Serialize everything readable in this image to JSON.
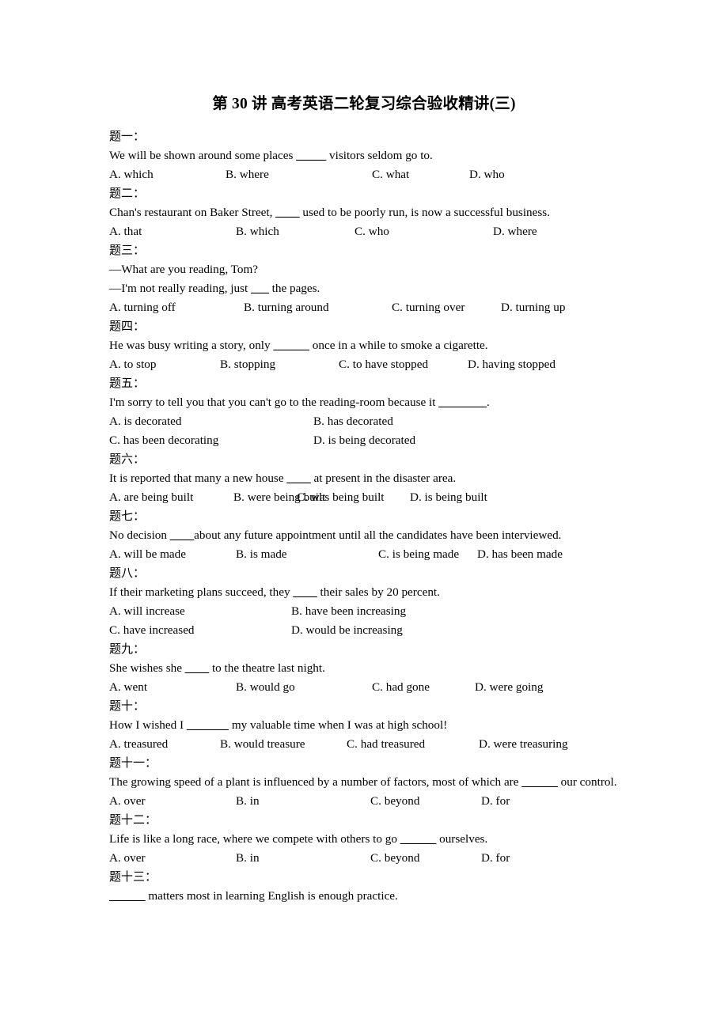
{
  "document": {
    "title": "第 30 讲 高考英语二轮复习综合验收精讲(三)"
  },
  "questions": [
    {
      "label": "题一：",
      "stem_before": "We will be shown around some places ",
      "blank": "_____",
      "stem_after": " visitors seldom go to.",
      "layout": "four-column",
      "options": [
        "A. which",
        "B. where",
        "C. what",
        "D. who"
      ],
      "columns": [
        0,
        147,
        332,
        455
      ]
    },
    {
      "label": "题二：",
      "stem_before": "Chan's restaurant on Baker Street, ",
      "blank": "____",
      "stem_after": " used to be poorly run, is now a successful business.",
      "layout": "four-column",
      "options": [
        "A. that",
        "B. which",
        "C. who",
        "D. where"
      ],
      "columns": [
        0,
        160,
        310,
        485
      ]
    },
    {
      "label": "题三：",
      "dialog": [
        "—What are you reading, Tom?"
      ],
      "stem_before": "—I'm not really reading, just ",
      "blank": "___",
      "stem_after": " the pages.",
      "layout": "four-column",
      "options": [
        "A. turning off",
        "B. turning around",
        "C. turning over",
        "D. turning up"
      ],
      "columns": [
        0,
        170,
        357,
        495
      ]
    },
    {
      "label": "题四：",
      "stem_before": "He was busy writing a story, only ",
      "blank": "______",
      "stem_after": " once in a while to smoke a cigarette.",
      "layout": "four-column",
      "options": [
        "A. to stop",
        "B. stopping",
        "C. to have stopped",
        "D. having stopped"
      ],
      "columns": [
        0,
        140,
        290,
        453
      ]
    },
    {
      "label": "题五：",
      "stem_before": "I'm sorry to tell you that you can't go to the reading-room because it ",
      "blank": "________",
      "stem_after": ".",
      "layout": "two-column",
      "options": [
        "A. is decorated",
        "B. has decorated",
        "C. has been decorating",
        "D. is being decorated"
      ],
      "columns": [
        0,
        258
      ]
    },
    {
      "label": "题六：",
      "stem_before": "It is reported that many a new house  ",
      "blank": "____",
      "stem_after": "  at present in the disaster area.",
      "layout": "four-column",
      "options": [
        "A. are being built",
        "B. were being built",
        "C. was being built",
        "D. is being built"
      ],
      "columns": [
        0,
        157,
        237,
        380
      ]
    },
    {
      "label": "题七：",
      "stem_before": "No decision ",
      "blank": "____",
      "stem_after": "about any future appointment until all the candidates have been interviewed.",
      "layout": "four-column",
      "options": [
        "A. will be made",
        "B. is made",
        "C. is being made",
        "D. has been made"
      ],
      "columns": [
        0,
        160,
        340,
        465
      ]
    },
    {
      "label": "题八：",
      "stem_before": "If their marketing plans succeed, they ",
      "blank": "____",
      "stem_after": " their sales by 20 percent.",
      "layout": "two-column",
      "options": [
        "A. will increase",
        "B. have been increasing",
        "C. have increased",
        "D. would be increasing"
      ],
      "columns": [
        0,
        230
      ]
    },
    {
      "label": "题九：",
      "stem_before": "She wishes she ",
      "blank": "____",
      "stem_after": " to the theatre last night.",
      "layout": "four-column",
      "options": [
        "A. went",
        "B. would go",
        "C. had gone",
        "D. were going"
      ],
      "columns": [
        0,
        160,
        332,
        462
      ]
    },
    {
      "label": "题十：",
      "stem_before": "How I wished I ",
      "blank": "_______",
      "stem_after": " my valuable time when I was at high school!",
      "layout": "four-column",
      "options": [
        "A. treasured",
        "B. would treasure",
        "C. had treasured",
        "D. were treasuring"
      ],
      "columns": [
        0,
        140,
        300,
        467
      ]
    },
    {
      "label": "题十一：",
      "stem_before": "The growing speed of a plant is influenced by a number of factors, most of which are ",
      "blank": "______",
      "stem_after": " our control.",
      "layout": "four-column",
      "wraps": true,
      "options": [
        "A. over",
        "B. in",
        "C. beyond",
        "D. for"
      ],
      "columns": [
        0,
        160,
        330,
        470
      ]
    },
    {
      "label": "题十二：",
      "stem_before": "Life is like a long race, where we compete with others to go ",
      "blank": "______",
      "stem_after": " ourselves.",
      "layout": "four-column",
      "options": [
        "A. over",
        "B. in",
        "C. beyond",
        "D. for"
      ],
      "columns": [
        0,
        160,
        330,
        470
      ]
    },
    {
      "label": "题十三：",
      "stem_before": "",
      "blank": "______",
      "stem_after": " matters most in learning English is enough practice.",
      "layout": "none",
      "options": [],
      "columns": []
    }
  ]
}
